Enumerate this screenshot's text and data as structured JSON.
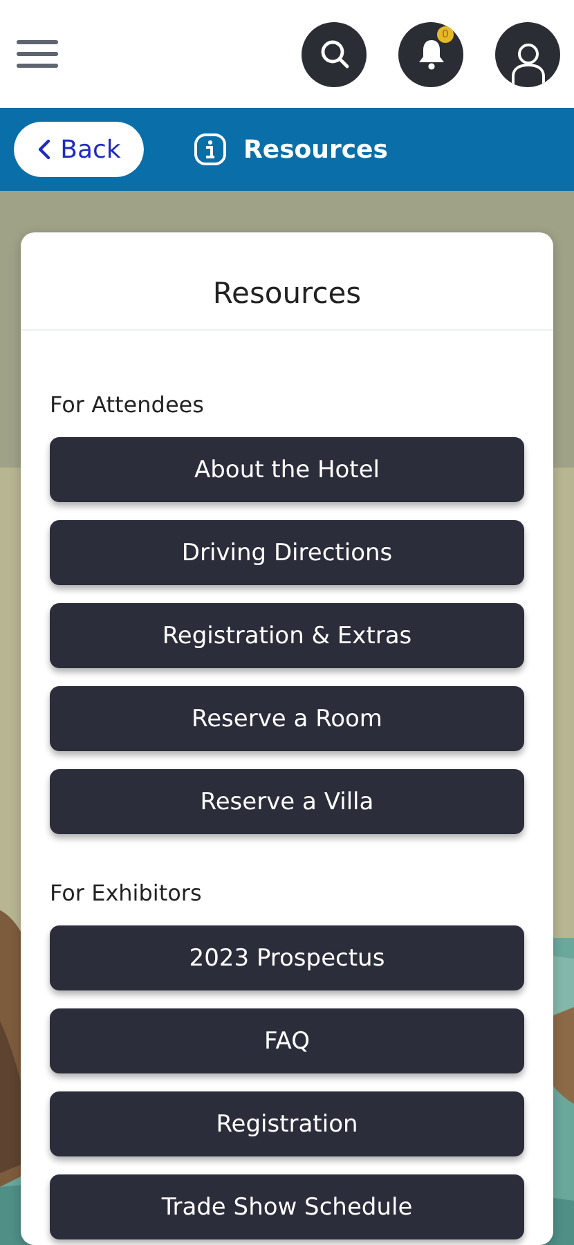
{
  "header": {
    "notification_badge": "0"
  },
  "nav_bar": {
    "back_label": "Back",
    "title": "Resources"
  },
  "card": {
    "title": "Resources",
    "sections": [
      {
        "heading": "For Attendees",
        "buttons": [
          "About the Hotel",
          "Driving Directions",
          "Registration & Extras",
          "Reserve a Room",
          "Reserve a Villa"
        ]
      },
      {
        "heading": "For Exhibitors",
        "buttons": [
          "2023 Prospectus",
          "FAQ",
          "Registration",
          "Trade Show Schedule"
        ]
      }
    ]
  }
}
